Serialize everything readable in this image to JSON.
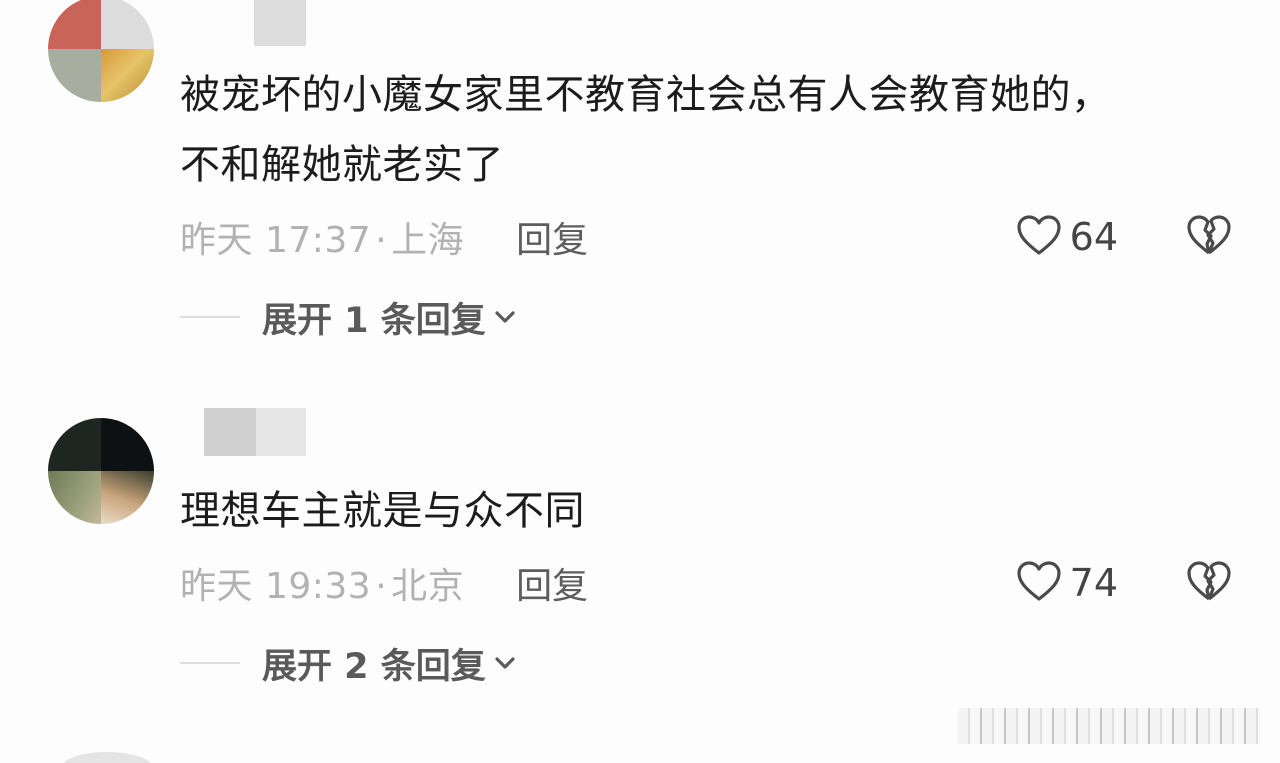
{
  "comments": [
    {
      "text_lines": [
        "被宠坏的小魔女家里不教育社会总有人会教育她的，",
        "不和解她就老实了"
      ],
      "time": "昨天 17:37",
      "location": "上海",
      "reply_label": "回复",
      "likes": "64",
      "expand_label": "展开 1 条回复"
    },
    {
      "text_lines": [
        "理想车主就是与众不同"
      ],
      "time": "昨天 19:33",
      "location": "北京",
      "reply_label": "回复",
      "likes": "74",
      "expand_label": "展开 2 条回复"
    }
  ],
  "meta_separator": "·",
  "icons": {
    "like": "heart-outline-icon",
    "dislike": "broken-heart-icon",
    "expand": "chevron-down-icon"
  },
  "colors": {
    "text": "#1c1c1c",
    "meta": "#b2b2b2",
    "reply": "#5d5d5d",
    "expand": "#5a5a5a"
  }
}
